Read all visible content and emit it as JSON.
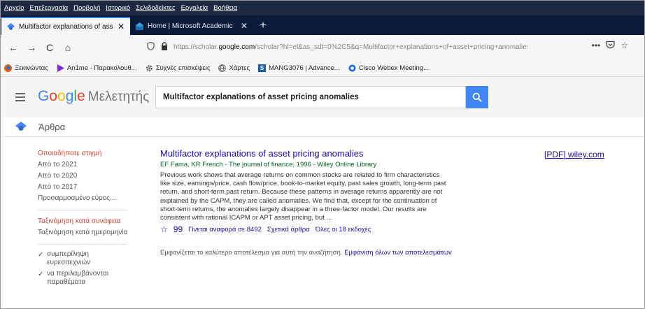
{
  "menubar": [
    "Αρχείο",
    "Επεξεργασία",
    "Προβολή",
    "Ιστορικό",
    "Σελιδοδείκτες",
    "Εργαλεία",
    "Βοήθεια"
  ],
  "tabs": [
    {
      "title": "Multifactor explanations of ass",
      "close": "✕",
      "icon": "scholar-icon"
    },
    {
      "title": "Home | Microsoft Academic",
      "close": "✕",
      "icon": "microsoft-academic-icon"
    }
  ],
  "new_tab": "+",
  "nav": {
    "back": "←",
    "forward": "→",
    "reload": "C",
    "home": "⌂",
    "url_prefix": "https://scholar.",
    "url_host": "google.com",
    "url_rest": "/scholar?hl=el&as_sdt=0%2C5&q=Multifactor+explanations+of+asset+pricing+anomalies&",
    "menu": "•••",
    "pocket": "⬡",
    "star": "☆"
  },
  "bookmarks": [
    {
      "label": "Ξεκινώντας",
      "icon": "firefox-icon",
      "color": "#e66000"
    },
    {
      "label": "An1me - Παρακολουθ...",
      "icon": "play-icon",
      "color": "#7b2bd8"
    },
    {
      "label": "Συχνές επισκέψεις",
      "icon": "gear-icon",
      "color": "#555555"
    },
    {
      "label": "Χάρτες",
      "icon": "globe-icon",
      "color": "#555555"
    },
    {
      "label": "MANG3076 | Advance...",
      "icon": "s-icon",
      "color": "#1c5fa8"
    },
    {
      "label": "Cisco Webex Meeting...",
      "icon": "webex-icon",
      "color": "#1d6bd8"
    }
  ],
  "scholar": {
    "logo_google": [
      "G",
      "o",
      "o",
      "g",
      "l",
      "e"
    ],
    "logo_suffix": "Μελετητής",
    "query": "Multifactor explanations of asset pricing anomalies",
    "section": "Άρθρα"
  },
  "filters": {
    "time": [
      "Οποιαδήποτε στιγμή",
      "Από το 2021",
      "Από το 2020",
      "Από το 2017",
      "Προσαρμοσμένο εύρος..."
    ],
    "sort": [
      "Ταξινόμηση κατά συνάφεια",
      "Ταξινόμηση κατά ημερομηνία"
    ],
    "checks": [
      "συμπερίληψη ευρεσιτεχνιών",
      "να περιλαμβάνονται παραθέματα"
    ]
  },
  "result": {
    "title": "Multifactor explanations of asset pricing anomalies",
    "meta": "EF Fama, KR French - The journal of finance, 1996 - Wiley Online Library",
    "snippet": "Previous work shows that average returns on common stocks are related to firm characteristics like size, earnings/price, cash flow/price, book-to-market equity, past sales growth, long-term past return, and short-term past return. Because these patterns in average returns apparently are not explained by the CAPM, they are called anomalies. We find that, except for the continuation of short-term returns, the anomalies largely disappear in a three-factor model. Our results are consistent with rational ICAPM or APT asset pricing, but ...",
    "links": [
      "Γίνεται αναφορά σε 8492",
      "Σχετικά άρθρα",
      "Όλες οι 18 εκδοχές"
    ],
    "pdf_tag": "[PDF]",
    "pdf_source": "wiley.com"
  },
  "best_note": {
    "text": "Εμφανίζεται το καλύτερο αποτέλεσμα για αυτή την αναζήτηση.",
    "link": "Εμφάνιση όλων των αποτελεσμάτων"
  }
}
